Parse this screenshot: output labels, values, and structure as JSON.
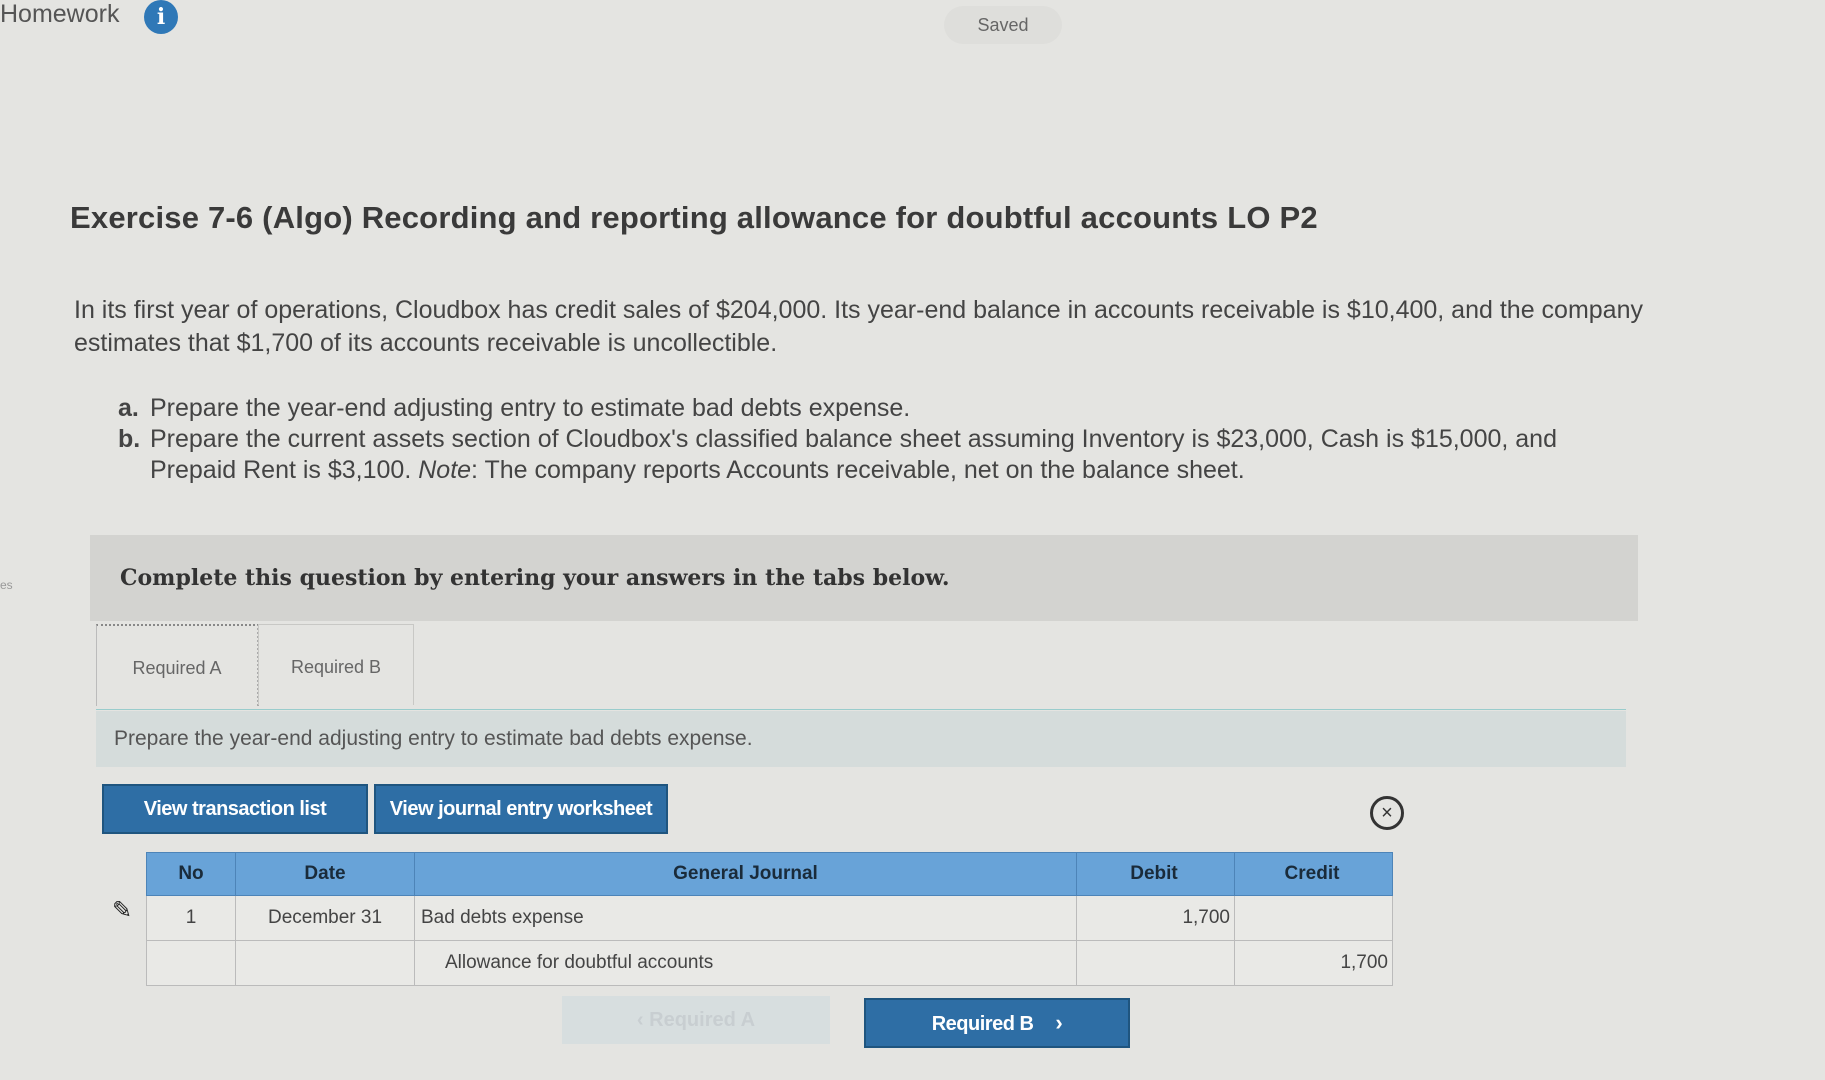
{
  "header": {
    "title": "Homework",
    "saved_label": "Saved"
  },
  "side_stub": "es",
  "exercise": {
    "title": "Exercise 7-6 (Algo) Recording and reporting allowance for doubtful accounts LO P2",
    "intro": "In its first year of operations, Cloudbox has credit sales of $204,000. Its year-end balance in accounts receivable is $10,400, and the company estimates that $1,700 of its accounts receivable is uncollectible.",
    "parts": [
      {
        "letter": "a.",
        "text": "Prepare the year-end adjusting entry to estimate bad debts expense."
      },
      {
        "letter": "b.",
        "text_before": "Prepare the current assets section of Cloudbox's classified balance sheet assuming Inventory is $23,000, Cash is $15,000, and Prepaid Rent is $3,100. ",
        "note_label": "Note",
        "text_after": ": The company reports Accounts receivable, net on the balance sheet."
      }
    ]
  },
  "banner": "Complete this question by entering your answers in the tabs below.",
  "tabs": [
    {
      "label": "Required A",
      "active": true
    },
    {
      "label": "Required B",
      "active": false
    }
  ],
  "instruction": "Prepare the year-end adjusting entry to estimate bad debts expense.",
  "buttons": {
    "view_transactions": "View transaction list",
    "view_worksheet": "View journal entry worksheet",
    "prev": "Required A",
    "next": "Required B"
  },
  "journal": {
    "headers": {
      "no": "No",
      "date": "Date",
      "account": "General Journal",
      "debit": "Debit",
      "credit": "Credit"
    },
    "rows": [
      {
        "no": "1",
        "date": "December 31",
        "account": "Bad debts expense",
        "debit": "1,700",
        "credit": ""
      },
      {
        "no": "",
        "date": "",
        "account": "Allowance for doubtful accounts",
        "debit": "",
        "credit": "1,700"
      }
    ]
  },
  "colors": {
    "primary_button": "#2e6ea5",
    "table_header": "#68a3d8",
    "info_icon": "#2f78b7"
  }
}
